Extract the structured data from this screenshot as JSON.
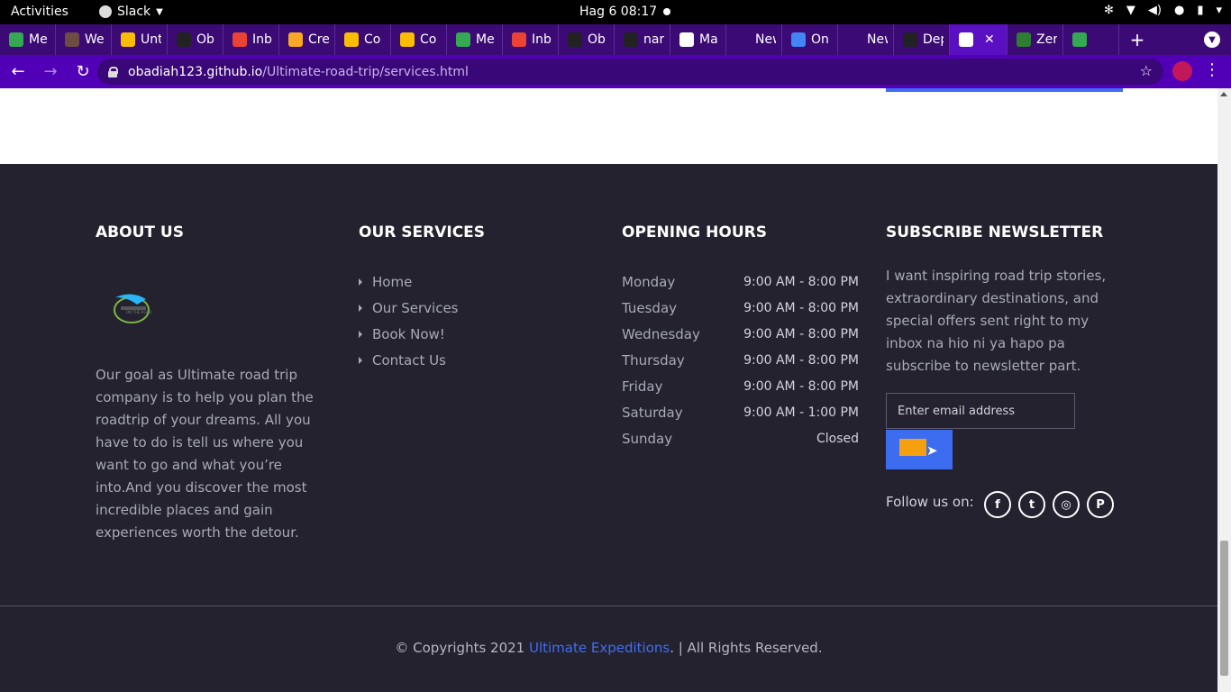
{
  "system_bar": {
    "activities": "Activities",
    "app_name": "Slack",
    "clock": "Hag 6  08:17"
  },
  "browser": {
    "tabs": [
      {
        "title": "Me",
        "color": "#34a853"
      },
      {
        "title": "We",
        "color": "#6d4c41"
      },
      {
        "title": "Unt",
        "color": "#fbbc04"
      },
      {
        "title": "Ob",
        "color": "#222222"
      },
      {
        "title": "Inb",
        "color": "#ea4335"
      },
      {
        "title": "Cre",
        "color": "#f9a825"
      },
      {
        "title": "Co",
        "color": "#fbbc04"
      },
      {
        "title": "Co",
        "color": "#fbbc04"
      },
      {
        "title": "Me",
        "color": "#34a853"
      },
      {
        "title": "Inb",
        "color": "#ea4335"
      },
      {
        "title": "Ob",
        "color": "#222222"
      },
      {
        "title": "nar",
        "color": "#222222"
      },
      {
        "title": "Ma",
        "color": "#ffffff"
      },
      {
        "title": "New T",
        "color": "#3b0a74"
      },
      {
        "title": "On",
        "color": "#4285f4"
      },
      {
        "title": "New T",
        "color": "#3b0a74"
      },
      {
        "title": "Dep",
        "color": "#222222"
      },
      {
        "title": "",
        "color": "#ffffff",
        "active": true
      },
      {
        "title": "Zer",
        "color": "#2e7d32"
      },
      {
        "title": "",
        "color": "#34a853"
      }
    ],
    "url_host": "obadiah123.github.io",
    "url_path": "/Ultimate-road-trip/services.html"
  },
  "footer": {
    "about": {
      "heading": "ABOUT US",
      "logo_text": "ON THE ROAD",
      "text": "Our goal as Ultimate road trip company is to help you plan the roadtrip of your dreams. All you have to do is tell us where you want to go and what you’re into.And you discover the most incredible places and gain experiences worth the detour."
    },
    "services": {
      "heading": "OUR SERVICES",
      "items": [
        "Home",
        "Our Services",
        "Book Now!",
        "Contact Us"
      ]
    },
    "hours": {
      "heading": "OPENING HOURS",
      "rows": [
        {
          "day": "Monday",
          "time": "9:00 AM - 8:00 PM"
        },
        {
          "day": "Tuesday",
          "time": "9:00 AM - 8:00 PM"
        },
        {
          "day": "Wednesday",
          "time": "9:00 AM - 8:00 PM"
        },
        {
          "day": "Thursday",
          "time": "9:00 AM - 8:00 PM"
        },
        {
          "day": "Friday",
          "time": "9:00 AM - 8:00 PM"
        },
        {
          "day": "Saturday",
          "time": "9:00 AM - 1:00 PM"
        },
        {
          "day": "Sunday",
          "time": "Closed"
        }
      ]
    },
    "newsletter": {
      "heading": "SUBSCRIBE NEWSLETTER",
      "text": "I want inspiring road trip stories, extraordinary destinations, and special offers sent right to my inbox na hio ni ya hapo pa subscribe to newsletter part.",
      "email_placeholder": "Enter email address",
      "follow_label": "Follow us on:",
      "socials": [
        {
          "name": "facebook-icon",
          "glyph": "f"
        },
        {
          "name": "twitter-icon",
          "glyph": "t"
        },
        {
          "name": "instagram-icon",
          "glyph": "◎"
        },
        {
          "name": "pinterest-icon",
          "glyph": "P"
        }
      ]
    },
    "copyright": {
      "prefix": "© Copyrights 2021 ",
      "brand": "Ultimate Expeditions",
      "suffix": ". | All Rights Reserved."
    }
  },
  "colors": {
    "footer_bg": "#23222e",
    "accent_blue": "#3f6ef5",
    "browser_purple": "#5200b8"
  }
}
